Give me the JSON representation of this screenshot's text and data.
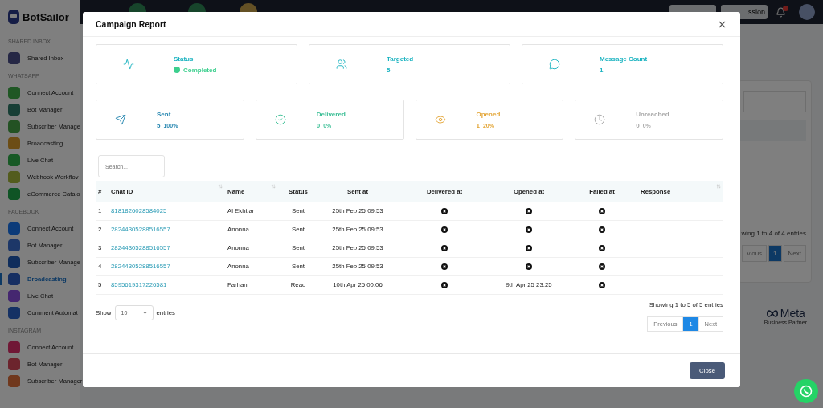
{
  "sidebar": {
    "brand": "BotSailor",
    "sections": [
      {
        "title": "SHARED INBOX",
        "items": [
          {
            "label": "Shared Inbox",
            "selected": false
          }
        ]
      },
      {
        "title": "WHATSAPP",
        "items": [
          {
            "label": "Connect Account",
            "selected": false
          },
          {
            "label": "Bot Manager",
            "selected": false
          },
          {
            "label": "Subscriber Manage",
            "selected": false
          },
          {
            "label": "Broadcasting",
            "selected": false
          },
          {
            "label": "Live Chat",
            "selected": false
          },
          {
            "label": "Webhook Workflov",
            "selected": false
          },
          {
            "label": "eCommerce Catalo",
            "selected": false
          }
        ]
      },
      {
        "title": "FACEBOOK",
        "items": [
          {
            "label": "Connect Account",
            "selected": false
          },
          {
            "label": "Bot Manager",
            "selected": false
          },
          {
            "label": "Subscriber Manage",
            "selected": false
          },
          {
            "label": "Broadcasting",
            "selected": true
          },
          {
            "label": "Live Chat",
            "selected": false
          },
          {
            "label": "Comment Automat",
            "selected": false
          }
        ]
      },
      {
        "title": "INSTAGRAM",
        "items": [
          {
            "label": "Connect Account",
            "selected": false
          },
          {
            "label": "Bot Manager",
            "selected": false
          },
          {
            "label": "Subscriber Manager",
            "selected": false
          }
        ]
      }
    ]
  },
  "topbar": {
    "button_text": "ssion",
    "notifications_badge": true
  },
  "background_panel": {
    "showing": "wing 1 to 4 of 4 entries",
    "pages": [
      {
        "label": "vious",
        "selected": false
      },
      {
        "label": "1",
        "selected": true
      },
      {
        "label": "Next",
        "selected": false
      }
    ],
    "partner": {
      "brand": "Meta",
      "caption": "Business Partner"
    }
  },
  "modal": {
    "title": "Campaign Report",
    "summary": [
      {
        "kind": "status",
        "label": "Status",
        "value": "Completed",
        "color": "#1ab3c0",
        "dot": {
          "color": "#3ccf8e"
        }
      },
      {
        "kind": "targeted",
        "label": "Targeted",
        "value": "5",
        "color": "#1ab3c0"
      },
      {
        "kind": "messages",
        "label": "Message Count",
        "value": "1",
        "color": "#1ab3c0"
      }
    ],
    "stats": [
      {
        "kind": "sent",
        "label": "Sent",
        "value": "5",
        "percent": "100%",
        "color": "#2586b0"
      },
      {
        "kind": "delivered",
        "label": "Delivered",
        "value": "0",
        "percent": "0%",
        "color": "#3cbf96"
      },
      {
        "kind": "opened",
        "label": "Opened",
        "value": "1",
        "percent": "20%",
        "color": "#e3a536"
      },
      {
        "kind": "unreached",
        "label": "Unreached",
        "value": "0",
        "percent": "0%",
        "color": "#a9a9a9"
      }
    ],
    "search": {
      "placeholder": "Search..."
    },
    "table": {
      "columns": [
        {
          "label": "#",
          "sortable": false
        },
        {
          "label": "Chat ID",
          "sortable": true
        },
        {
          "label": "Name",
          "sortable": true
        },
        {
          "label": "Status",
          "sortable": false
        },
        {
          "label": "Sent at",
          "sortable": false
        },
        {
          "label": "Delivered at",
          "sortable": false
        },
        {
          "label": "Opened at",
          "sortable": false
        },
        {
          "label": "Failed at",
          "sortable": false
        },
        {
          "label": "Response",
          "sortable": true
        }
      ],
      "rows": [
        {
          "index": "1",
          "chat_id": "8181826028584025",
          "name": "Al Ekhtiar",
          "status": "Sent",
          "sent_at": "25th Feb 25 09:53",
          "delivered_at": {
            "kind": "missing"
          },
          "opened_at": {
            "kind": "missing"
          },
          "failed_at": {
            "kind": "missing"
          }
        },
        {
          "index": "2",
          "chat_id": "28244305288516557",
          "name": "Anonna",
          "status": "Sent",
          "sent_at": "25th Feb 25 09:53",
          "delivered_at": {
            "kind": "missing"
          },
          "opened_at": {
            "kind": "missing"
          },
          "failed_at": {
            "kind": "missing"
          }
        },
        {
          "index": "3",
          "chat_id": "28244305288516557",
          "name": "Anonna",
          "status": "Sent",
          "sent_at": "25th Feb 25 09:53",
          "delivered_at": {
            "kind": "missing"
          },
          "opened_at": {
            "kind": "missing"
          },
          "failed_at": {
            "kind": "missing"
          }
        },
        {
          "index": "4",
          "chat_id": "28244305288516557",
          "name": "Anonna",
          "status": "Sent",
          "sent_at": "25th Feb 25 09:53",
          "delivered_at": {
            "kind": "missing"
          },
          "opened_at": {
            "kind": "missing"
          },
          "failed_at": {
            "kind": "missing"
          }
        },
        {
          "index": "5",
          "chat_id": "8595619317226581",
          "name": "Farhan",
          "status": "Read",
          "sent_at": "10th Apr 25 00:06",
          "delivered_at": {
            "kind": "missing"
          },
          "opened_at": {
            "kind": "time",
            "text": "9th Apr 25 23:25"
          },
          "failed_at": {
            "kind": "missing"
          }
        }
      ]
    },
    "length": {
      "before": "Show",
      "value": "10",
      "after": "entries"
    },
    "info": "Showing 1 to 5 of 5 entries",
    "pages": [
      {
        "label": "Previous",
        "selected": false
      },
      {
        "label": "1",
        "selected": true
      },
      {
        "label": "Next",
        "selected": false
      }
    ],
    "close_button": "Close"
  }
}
